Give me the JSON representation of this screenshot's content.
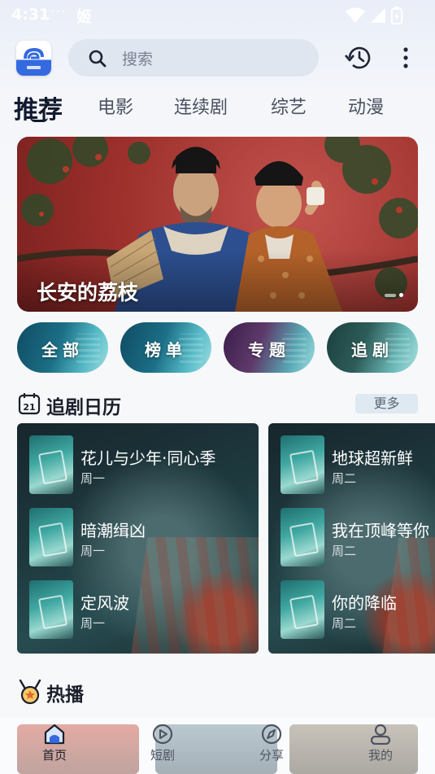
{
  "status_bar": {
    "time": "4:31",
    "dots": "···",
    "app_glyph": "姬"
  },
  "header": {
    "search_placeholder": "搜索",
    "logo_icon": "app-logo",
    "history_icon": "history-icon",
    "more_icon": "more-vertical-icon"
  },
  "tabs": [
    {
      "label": "推荐",
      "active": true
    },
    {
      "label": "电影",
      "active": false
    },
    {
      "label": "连续剧",
      "active": false
    },
    {
      "label": "综艺",
      "active": false
    },
    {
      "label": "动漫",
      "active": false
    }
  ],
  "banner": {
    "title": "长安的荔枝"
  },
  "categories": [
    {
      "label": "全部"
    },
    {
      "label": "榜单"
    },
    {
      "label": "专题"
    },
    {
      "label": "追剧"
    }
  ],
  "schedule_section": {
    "title": "追剧日历",
    "more_label": "更多",
    "columns": [
      {
        "items": [
          {
            "title": "花儿与少年·同心季",
            "day": "周一"
          },
          {
            "title": "暗潮缉凶",
            "day": "周一"
          },
          {
            "title": "定风波",
            "day": "周一"
          }
        ]
      },
      {
        "items": [
          {
            "title": "地球超新鲜",
            "day": "周二"
          },
          {
            "title": "我在顶峰等你",
            "day": "周二"
          },
          {
            "title": "你的降临",
            "day": "周二"
          }
        ]
      }
    ]
  },
  "hot_section": {
    "title": "热播"
  },
  "bottom_nav": [
    {
      "label": "首页",
      "icon": "home-icon",
      "active": true
    },
    {
      "label": "短剧",
      "icon": "play-circle-icon",
      "active": false
    },
    {
      "label": "分享",
      "icon": "compass-icon",
      "active": false
    },
    {
      "label": "我的",
      "icon": "user-icon",
      "active": false
    }
  ],
  "colors": {
    "accent": "#3469e0",
    "text_primary": "#1a1f2b",
    "search_bg": "#e0e6f0"
  }
}
